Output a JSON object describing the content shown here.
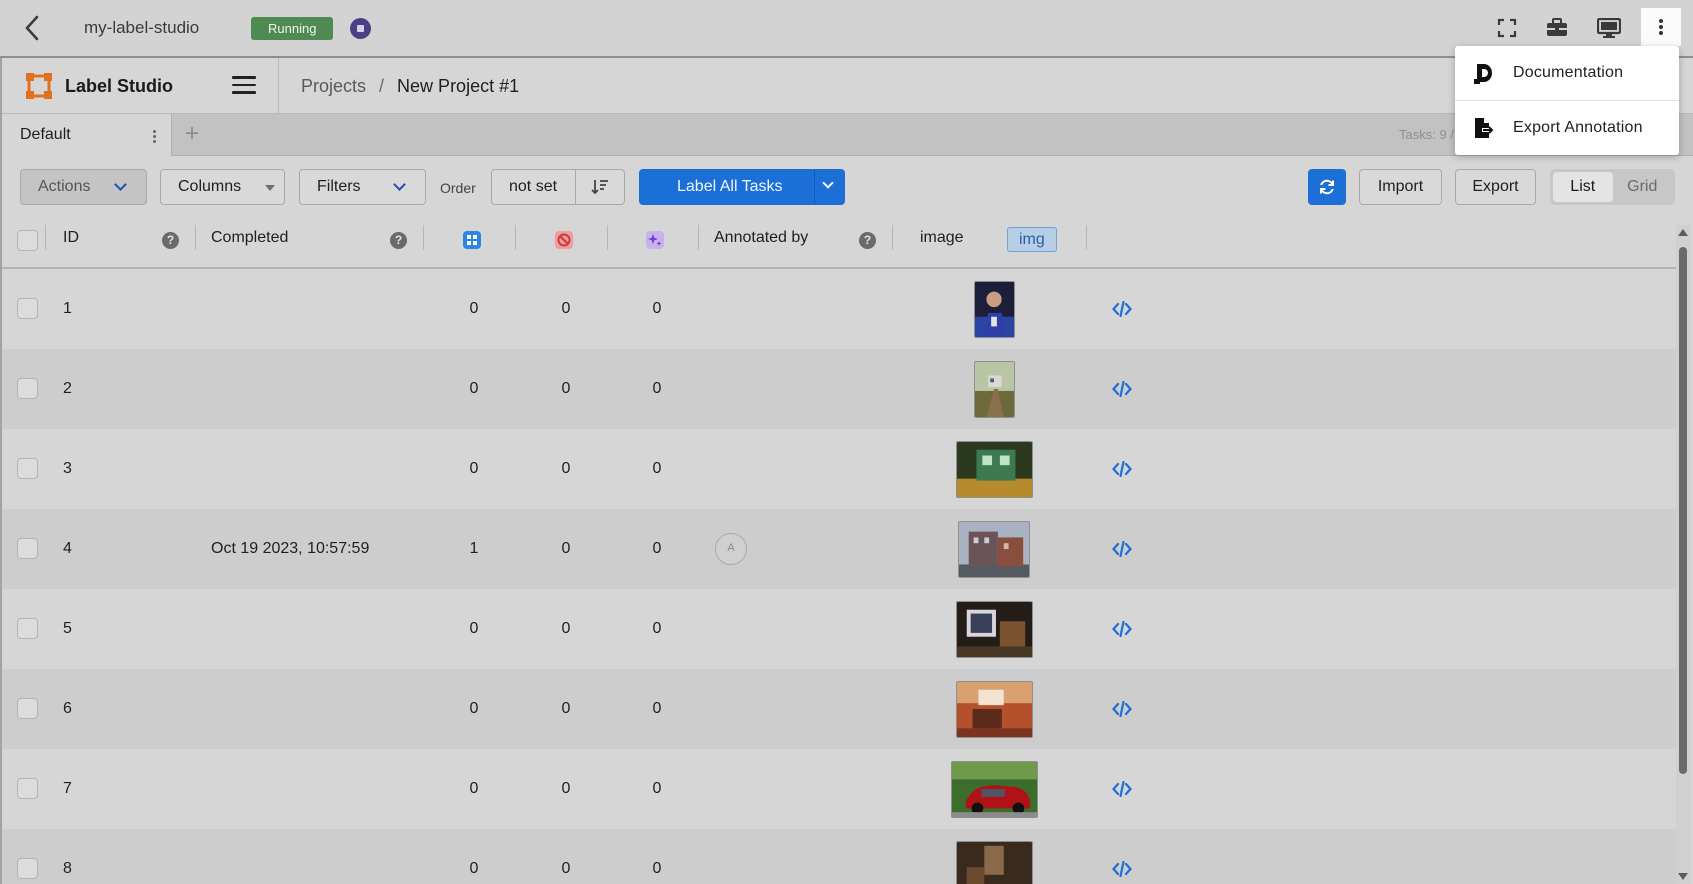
{
  "host": {
    "app_name": "my-label-studio",
    "status": "Running",
    "menu": {
      "items": [
        {
          "label": "Documentation",
          "icon": "documentation-icon"
        },
        {
          "label": "Export Annotation",
          "icon": "export-file-icon"
        }
      ]
    }
  },
  "app": {
    "logo_text": "Label Studio",
    "breadcrumb": {
      "projects": "Projects",
      "separator": "/",
      "current": "New Project #1"
    },
    "tabs": [
      {
        "label": "Default"
      }
    ],
    "tasks_count": "Tasks: 9 /",
    "toolbar": {
      "actions": "Actions",
      "columns": "Columns",
      "filters": "Filters",
      "order_label": "Order",
      "order_value": "not set",
      "label_all": "Label All Tasks",
      "import": "Import",
      "export": "Export",
      "view_list": "List",
      "view_grid": "Grid"
    },
    "table": {
      "headers": {
        "id": "ID",
        "completed": "Completed",
        "annotated_by": "Annotated by",
        "image": "image",
        "image_tag": "img"
      },
      "rows": [
        {
          "id": "1",
          "completed": "",
          "annotations": "0",
          "cancelled": "0",
          "predictions": "0",
          "annotator": ""
        },
        {
          "id": "2",
          "completed": "",
          "annotations": "0",
          "cancelled": "0",
          "predictions": "0",
          "annotator": ""
        },
        {
          "id": "3",
          "completed": "",
          "annotations": "0",
          "cancelled": "0",
          "predictions": "0",
          "annotator": ""
        },
        {
          "id": "4",
          "completed": "Oct 19 2023, 10:57:59",
          "annotations": "1",
          "cancelled": "0",
          "predictions": "0",
          "annotator": "A"
        },
        {
          "id": "5",
          "completed": "",
          "annotations": "0",
          "cancelled": "0",
          "predictions": "0",
          "annotator": ""
        },
        {
          "id": "6",
          "completed": "",
          "annotations": "0",
          "cancelled": "0",
          "predictions": "0",
          "annotator": ""
        },
        {
          "id": "7",
          "completed": "",
          "annotations": "0",
          "cancelled": "0",
          "predictions": "0",
          "annotator": ""
        },
        {
          "id": "8",
          "completed": "",
          "annotations": "0",
          "cancelled": "0",
          "predictions": "0",
          "annotator": ""
        }
      ]
    }
  },
  "colors": {
    "primary": "#1c6fd6",
    "running": "#4f8a52",
    "logo": "#e2711f"
  }
}
